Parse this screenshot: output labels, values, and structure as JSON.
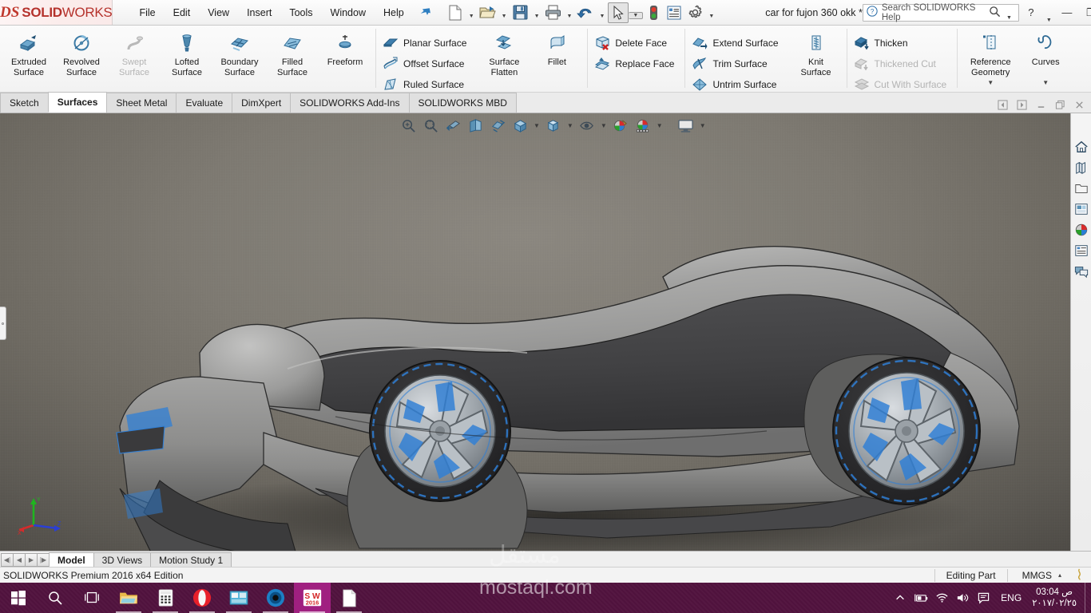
{
  "app": {
    "brand_ds": "DS",
    "brand_bold": "SOLID",
    "brand_light": "WORKS",
    "document_title": "car for fujon 360 okk *",
    "status_edition": "SOLIDWORKS Premium 2016 x64 Edition"
  },
  "menu": {
    "items": [
      {
        "label": "File"
      },
      {
        "label": "Edit"
      },
      {
        "label": "View"
      },
      {
        "label": "Insert"
      },
      {
        "label": "Tools"
      },
      {
        "label": "Window"
      },
      {
        "label": "Help"
      }
    ],
    "pin_icon": "pushpin-icon"
  },
  "quick_access": {
    "buttons": [
      {
        "name": "new-document",
        "icon": "new-file-icon",
        "has_dropdown": true
      },
      {
        "name": "open-document",
        "icon": "open-folder-icon",
        "has_dropdown": true
      },
      {
        "name": "save-document",
        "icon": "floppy-save-icon",
        "has_dropdown": true
      },
      {
        "name": "print-document",
        "icon": "printer-icon",
        "has_dropdown": true
      },
      {
        "name": "undo",
        "icon": "undo-arrow-icon",
        "has_dropdown": true
      },
      {
        "name": "select",
        "icon": "cursor-arrow-icon",
        "has_dropdown": true,
        "selected": true
      },
      {
        "name": "rebuild",
        "icon": "traffic-light-icon",
        "has_dropdown": false
      },
      {
        "name": "file-properties",
        "icon": "properties-list-icon",
        "has_dropdown": false
      },
      {
        "name": "options",
        "icon": "gear-icon",
        "has_dropdown": true
      }
    ]
  },
  "help_search": {
    "placeholder": "Search SOLIDWORKS Help",
    "icon": "question-circle-icon",
    "magnifier": "magnifier-icon"
  },
  "window_controls": {
    "help": "?",
    "minimize": "—",
    "restore": "❐",
    "close": "✕"
  },
  "ribbon": {
    "groups": [
      {
        "name": "surface-create-group",
        "big_buttons": [
          {
            "name": "extruded-surface",
            "line1": "Extruded",
            "line2": "Surface",
            "icon": "extruded-surface-icon",
            "disabled": false
          },
          {
            "name": "revolved-surface",
            "line1": "Revolved",
            "line2": "Surface",
            "icon": "revolved-surface-icon",
            "disabled": false
          },
          {
            "name": "swept-surface",
            "line1": "Swept",
            "line2": "Surface",
            "icon": "swept-surface-icon",
            "disabled": true
          },
          {
            "name": "lofted-surface",
            "line1": "Lofted",
            "line2": "Surface",
            "icon": "lofted-surface-icon",
            "disabled": false
          },
          {
            "name": "boundary-surface",
            "line1": "Boundary",
            "line2": "Surface",
            "icon": "boundary-surface-icon",
            "disabled": false
          },
          {
            "name": "filled-surface",
            "line1": "Filled",
            "line2": "Surface",
            "icon": "filled-surface-icon",
            "disabled": false
          },
          {
            "name": "freeform",
            "line1": "Freeform",
            "line2": "",
            "icon": "freeform-icon",
            "disabled": false
          }
        ]
      },
      {
        "name": "surface-modify-group",
        "small_buttons": [
          {
            "name": "planar-surface",
            "label": "Planar Surface",
            "icon": "planar-surface-icon",
            "disabled": false
          },
          {
            "name": "offset-surface",
            "label": "Offset Surface",
            "icon": "offset-surface-icon",
            "disabled": false
          },
          {
            "name": "ruled-surface",
            "label": "Ruled Surface",
            "icon": "ruled-surface-icon",
            "disabled": false
          }
        ],
        "big_buttons": [
          {
            "name": "surface-flatten",
            "line1": "Surface",
            "line2": "Flatten",
            "icon": "surface-flatten-icon",
            "disabled": false
          },
          {
            "name": "fillet",
            "line1": "Fillet",
            "line2": "",
            "icon": "fillet-icon",
            "disabled": false
          }
        ]
      },
      {
        "name": "face-group",
        "small_buttons": [
          {
            "name": "delete-face",
            "label": "Delete Face",
            "icon": "delete-face-icon",
            "disabled": false
          },
          {
            "name": "replace-face",
            "label": "Replace Face",
            "icon": "replace-face-icon",
            "disabled": false
          }
        ]
      },
      {
        "name": "surface-edit-group",
        "small_buttons": [
          {
            "name": "extend-surface",
            "label": "Extend Surface",
            "icon": "extend-surface-icon",
            "disabled": false
          },
          {
            "name": "trim-surface",
            "label": "Trim Surface",
            "icon": "trim-surface-icon",
            "disabled": false
          },
          {
            "name": "untrim-surface",
            "label": "Untrim Surface",
            "icon": "untrim-surface-icon",
            "disabled": false
          }
        ],
        "big_buttons": [
          {
            "name": "knit-surface",
            "line1": "Knit",
            "line2": "Surface",
            "icon": "knit-surface-icon",
            "disabled": false
          }
        ]
      },
      {
        "name": "thicken-group",
        "small_buttons": [
          {
            "name": "thicken",
            "label": "Thicken",
            "icon": "thicken-icon",
            "disabled": false
          },
          {
            "name": "thickened-cut",
            "label": "Thickened Cut",
            "icon": "thickened-cut-icon",
            "disabled": true
          },
          {
            "name": "cut-with-surface",
            "label": "Cut With Surface",
            "icon": "cut-with-surface-icon",
            "disabled": true
          }
        ]
      },
      {
        "name": "reference-group",
        "big_buttons": [
          {
            "name": "reference-geometry",
            "line1": "Reference",
            "line2": "Geometry",
            "icon": "reference-geometry-icon",
            "disabled": false,
            "has_dropdown": true
          },
          {
            "name": "curves",
            "line1": "Curves",
            "line2": "",
            "icon": "curves-icon",
            "disabled": false,
            "has_dropdown": true
          }
        ]
      }
    ]
  },
  "command_tabs": {
    "items": [
      {
        "label": "Sketch",
        "active": false
      },
      {
        "label": "Surfaces",
        "active": true
      },
      {
        "label": "Sheet Metal",
        "active": false
      },
      {
        "label": "Evaluate",
        "active": false
      },
      {
        "label": "DimXpert",
        "active": false
      },
      {
        "label": "SOLIDWORKS Add-Ins",
        "active": false
      },
      {
        "label": "SOLIDWORKS MBD",
        "active": false
      }
    ],
    "right_buttons": [
      {
        "name": "doc-prev",
        "icon": "left-box-icon"
      },
      {
        "name": "doc-next",
        "icon": "right-box-icon"
      },
      {
        "name": "doc-minimize",
        "icon": "minimize-icon"
      },
      {
        "name": "doc-restore",
        "icon": "restore-icon"
      },
      {
        "name": "doc-close",
        "icon": "close-icon"
      }
    ]
  },
  "view_toolbar": {
    "buttons": [
      {
        "name": "zoom-to-fit",
        "icon": "zoom-to-fit-icon",
        "has_dropdown": false
      },
      {
        "name": "zoom-to-area",
        "icon": "zoom-to-area-icon",
        "has_dropdown": false
      },
      {
        "name": "previous-view",
        "icon": "previous-view-icon",
        "has_dropdown": false
      },
      {
        "name": "section-view",
        "icon": "section-view-icon",
        "has_dropdown": false
      },
      {
        "name": "view-orientation-hide",
        "icon": "hide-show-items-icon",
        "has_dropdown": false
      },
      {
        "name": "view-orientation",
        "icon": "view-orientation-cube-icon",
        "has_dropdown": true
      },
      {
        "name": "display-style",
        "icon": "display-style-box-icon",
        "has_dropdown": true
      },
      {
        "name": "hide-show-items",
        "icon": "eye-icon",
        "has_dropdown": true
      },
      {
        "name": "edit-appearance",
        "icon": "appearance-sphere-icon",
        "has_dropdown": false
      },
      {
        "name": "apply-scene",
        "icon": "scene-sphere-icon",
        "has_dropdown": true
      },
      {
        "name": "view-settings",
        "icon": "monitor-icon",
        "has_dropdown": true
      }
    ]
  },
  "task_pane": {
    "buttons": [
      {
        "name": "sw-resources",
        "icon": "home-icon"
      },
      {
        "name": "design-library",
        "icon": "books-icon"
      },
      {
        "name": "file-explorer",
        "icon": "folder-icon"
      },
      {
        "name": "view-palette",
        "icon": "view-palette-icon"
      },
      {
        "name": "appearances-scenes",
        "icon": "color-sphere-icon"
      },
      {
        "name": "custom-properties",
        "icon": "properties-list-icon"
      },
      {
        "name": "solidworks-forum",
        "icon": "forum-bubbles-icon"
      }
    ]
  },
  "model": {
    "triad": {
      "x_axis_color": "#d42b2b",
      "y_axis_color": "#1fb51f",
      "z_axis_color": "#2b3fd4",
      "x_label": "X",
      "y_label": "Y",
      "z_label": "Z"
    },
    "body_color": "#8b8b8b",
    "body_dark_color": "#4a4a4c",
    "highlight_color": "#2f7fd6",
    "background_top": "#8c8880",
    "background_bottom": "#4c4944"
  },
  "bottom_tabs": {
    "nav_arrows": [
      "❘◀",
      "◀",
      "▶",
      "▶❘"
    ],
    "items": [
      {
        "label": "Model",
        "active": true
      },
      {
        "label": "3D Views",
        "active": false
      },
      {
        "label": "Motion Study 1",
        "active": false
      }
    ]
  },
  "status_bar": {
    "left_text": "SOLIDWORKS Premium 2016 x64 Edition",
    "editing_state": "Editing Part",
    "units": "MMGS",
    "units_caret": "▴",
    "flag_icon": "flag-icon"
  },
  "watermark": {
    "arabic": "مستقل",
    "latin": "mostaql.com"
  },
  "taskbar": {
    "items": [
      {
        "name": "start-button",
        "icon": "windows-logo-icon",
        "open": false
      },
      {
        "name": "search-button",
        "icon": "magnifier-icon",
        "open": false
      },
      {
        "name": "task-view-button",
        "icon": "task-view-icon",
        "open": false
      },
      {
        "name": "file-explorer-task",
        "icon": "folder-icon",
        "open": true
      },
      {
        "name": "calculator-task",
        "icon": "calculator-icon",
        "open": true
      },
      {
        "name": "opera-task",
        "icon": "opera-icon",
        "open": true
      },
      {
        "name": "photos-task",
        "icon": "photos-icon",
        "open": true
      },
      {
        "name": "edge-task",
        "icon": "circle-browser-icon",
        "open": true
      },
      {
        "name": "solidworks-task",
        "icon": "solidworks-2016-icon",
        "open": true,
        "active": true,
        "badge": "2016"
      },
      {
        "name": "document-task",
        "icon": "document-icon",
        "open": true
      }
    ],
    "tray": {
      "overflow_icon": "chevron-up-icon",
      "icons": [
        {
          "name": "battery-icon",
          "glyph": "⬜"
        },
        {
          "name": "wifi-icon",
          "glyph": "◠"
        },
        {
          "name": "volume-icon",
          "glyph": "ᴘ"
        },
        {
          "name": "action-center-icon",
          "glyph": "☰"
        }
      ],
      "language": "ENG",
      "time": "03:04 ص",
      "date": "٢٠١٧/٠٢/٢٥"
    }
  }
}
